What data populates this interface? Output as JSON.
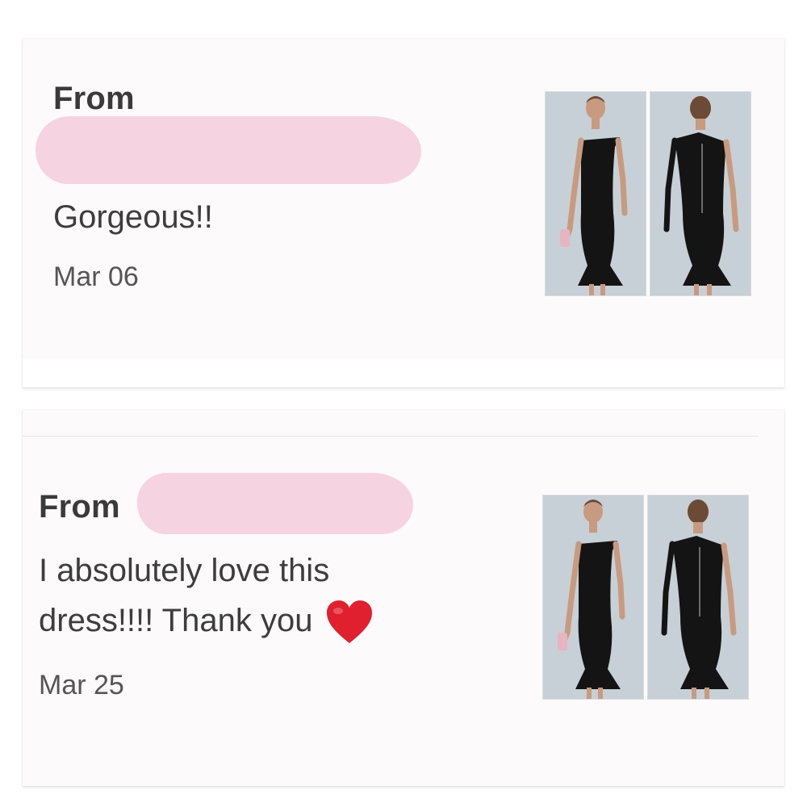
{
  "reviews": [
    {
      "from_label": "From",
      "message_lines": [
        "Gorgeous!!"
      ],
      "date": "Mar 06",
      "thumbnails": [
        "front-view",
        "back-view"
      ]
    },
    {
      "from_label": "From",
      "message_lines": [
        "I absolutely love this",
        "dress!!!! Thank you"
      ],
      "date": "Mar 25",
      "thumbnails": [
        "front-view",
        "back-view"
      ]
    }
  ],
  "colors": {
    "card_bg": "#fcfafb",
    "redaction": "#f6d3e1",
    "heart": "#e0202e",
    "dress": "#141414"
  },
  "icons": {
    "heart": "red-heart-emoji"
  }
}
